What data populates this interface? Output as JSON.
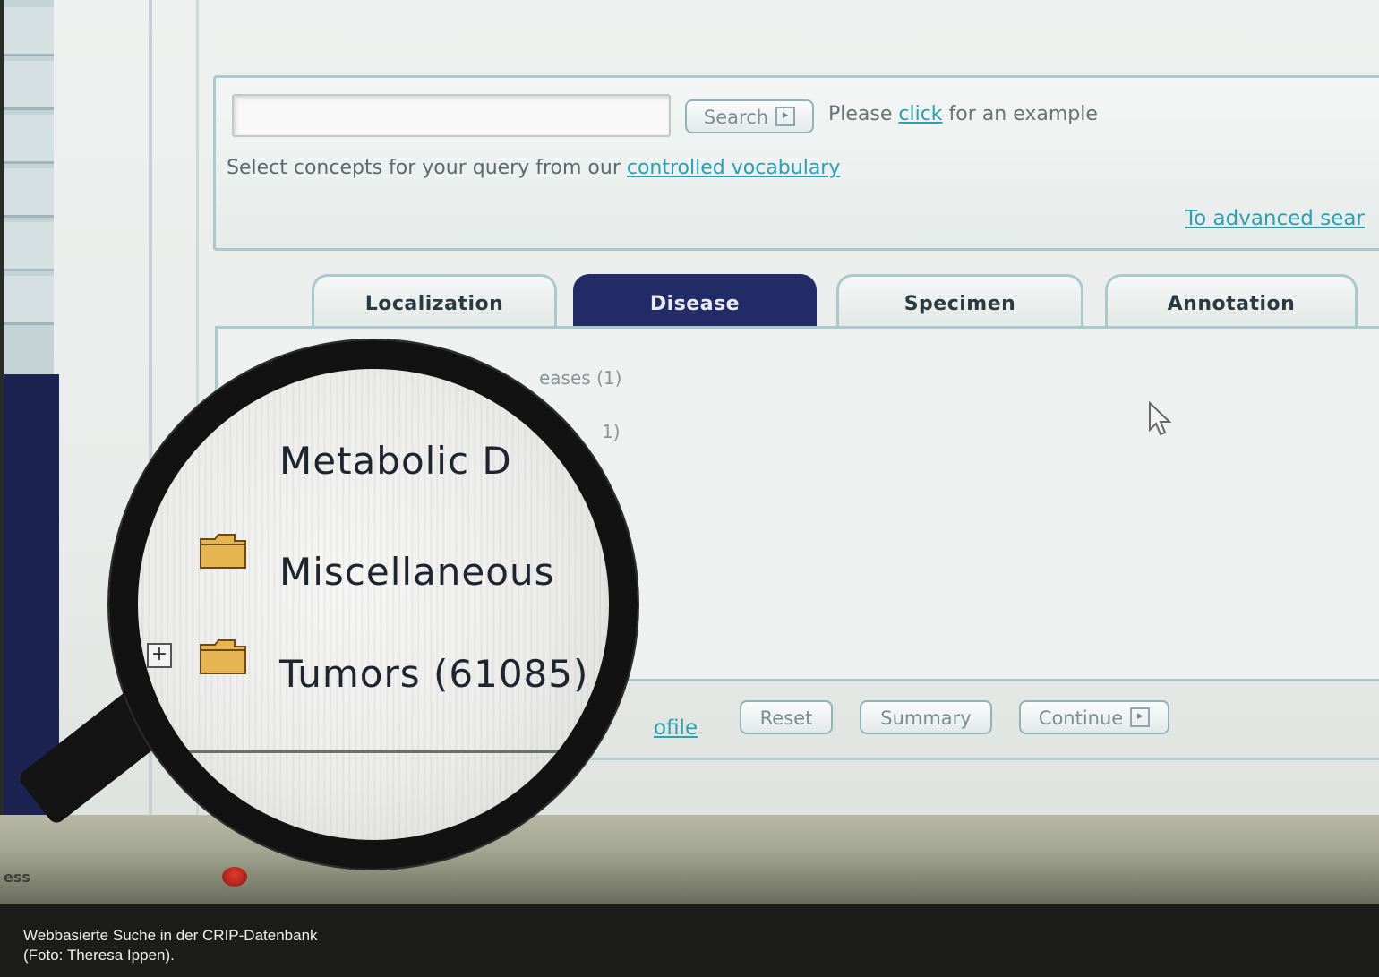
{
  "search": {
    "button_label": "Search",
    "button_icon": "arrow-box-icon",
    "please_prefix": "Please ",
    "click_link": "click",
    "please_suffix": " for an example",
    "select_text": "Select concepts for your query from our ",
    "vocabulary_link": "controlled vocabulary",
    "advanced_link": "To advanced sear"
  },
  "tabs": [
    {
      "label": "Localization",
      "active": false
    },
    {
      "label": "Disease",
      "active": true
    },
    {
      "label": "Specimen",
      "active": false
    },
    {
      "label": "Annotation",
      "active": false
    }
  ],
  "tree": {
    "background_row1": "eases (1)",
    "background_row2": "1)",
    "magnified_items": [
      {
        "label": "Metabolic D",
        "icon": "folder-icon"
      },
      {
        "label": "Miscellaneous ",
        "icon": "folder-icon"
      },
      {
        "label": "Tumors (61085)",
        "icon": "folder-icon",
        "expander": "+"
      }
    ]
  },
  "footer": {
    "profile_link": "ofile",
    "reset_label": "Reset",
    "summary_label": "Summary",
    "continue_label": "Continue"
  },
  "taskbar": {
    "text": "ess"
  },
  "caption": {
    "line1": "Webbasierte Suche in der CRIP-Datenbank",
    "line2": "(Foto: Theresa Ippen)."
  },
  "colors": {
    "active_tab": "#232b66",
    "panel_border": "#a9cacc",
    "link": "#2c9fb0",
    "caption_bg": "#1c1c1a"
  }
}
